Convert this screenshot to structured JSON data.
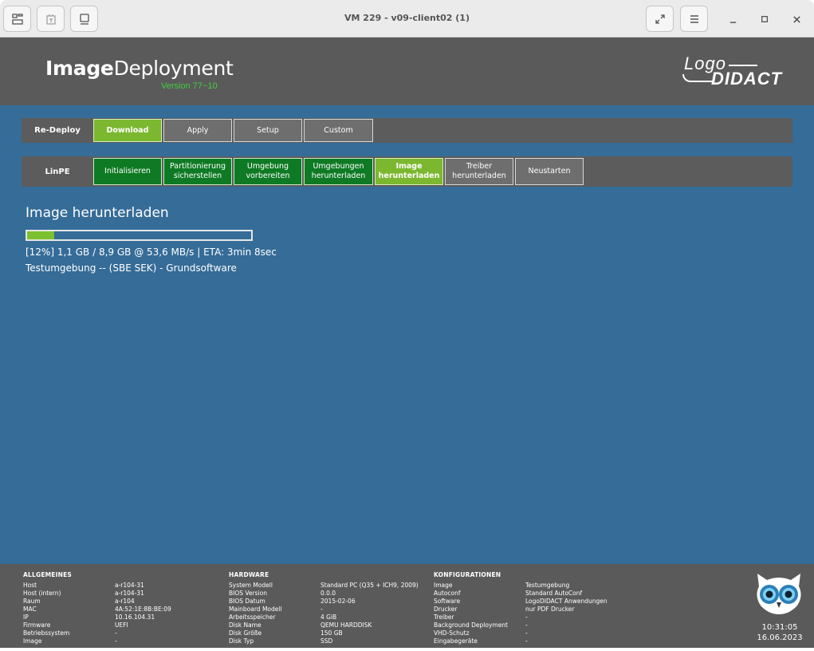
{
  "window": {
    "title": "VM 229 - v09-client02 (1)",
    "left_buttons": [
      "overview-icon",
      "usb-icon",
      "display-icon"
    ],
    "right_buttons": [
      "fullscreen-icon",
      "menu-icon"
    ],
    "controls": [
      "minimize-icon",
      "maximize-icon",
      "close-icon"
    ]
  },
  "header": {
    "brand_bold": "Image",
    "brand_light": "Deployment",
    "version": "Version 77~10",
    "logo_top": "Logo",
    "logo_bottom": "DIDACT"
  },
  "redeploy_row": {
    "label": "Re-Deploy",
    "steps": [
      {
        "label": "Download",
        "state": "active"
      },
      {
        "label": "Apply",
        "state": "inactive"
      },
      {
        "label": "Setup",
        "state": "inactive"
      },
      {
        "label": "Custom",
        "state": "inactive"
      }
    ]
  },
  "linpe_row": {
    "label": "LinPE",
    "steps": [
      {
        "line1": "Initialisieren",
        "line2": "",
        "state": "done"
      },
      {
        "line1": "Partitionierung",
        "line2": "sicherstellen",
        "state": "done"
      },
      {
        "line1": "Umgebung",
        "line2": "vorbereiten",
        "state": "done"
      },
      {
        "line1": "Umgebungen",
        "line2": "herunterladen",
        "state": "done"
      },
      {
        "line1": "Image",
        "line2": "herunterladen",
        "state": "active"
      },
      {
        "line1": "Treiber",
        "line2": "herunterladen",
        "state": "inactive"
      },
      {
        "line1": "Neustarten",
        "line2": "",
        "state": "inactive"
      }
    ]
  },
  "progress": {
    "title": "Image herunterladen",
    "percent": 12,
    "status_text": "[12%] 1,1 GB / 8,9 GB @ 53,6 MB/s | ETA: 3min 8sec",
    "environment_text": "Testumgebung -- (SBE SEK) - Grundsoftware"
  },
  "footer": {
    "allgemeines": {
      "heading": "ALLGEMEINES",
      "rows": [
        [
          "Host",
          "a-r104-31"
        ],
        [
          "Host (intern)",
          "a-r104-31"
        ],
        [
          "Raum",
          "a-r104"
        ],
        [
          "MAC",
          "4A:52:1E:8B:BE:09"
        ],
        [
          "IP",
          "10.16.104.31"
        ],
        [
          "Firmware",
          "UEFI"
        ],
        [
          "Betriebssystem",
          "-"
        ],
        [
          "Image",
          "-"
        ]
      ]
    },
    "hardware": {
      "heading": "HARDWARE",
      "rows": [
        [
          "System Modell",
          "Standard PC (Q35 + ICH9, 2009)"
        ],
        [
          "BIOS Version",
          "0.0.0"
        ],
        [
          "BIOS Datum",
          "2015-02-06"
        ],
        [
          "Mainboard Modell",
          "-"
        ],
        [
          "Arbeitsspeicher",
          "4 GiB"
        ],
        [
          "Disk Name",
          "QEMU HARDDISK"
        ],
        [
          "Disk Größe",
          "150 GB"
        ],
        [
          "Disk Typ",
          "SSD"
        ]
      ]
    },
    "konfigurationen": {
      "heading": "KONFIGURATIONEN",
      "rows": [
        [
          "Image",
          "Testumgebung"
        ],
        [
          "Autoconf",
          "Standard AutoConf"
        ],
        [
          "Software",
          "LogoDIDACT Anwendungen"
        ],
        [
          "Drucker",
          "nur PDF Drucker"
        ],
        [
          "Treiber",
          "-"
        ],
        [
          "Background Deployment",
          "-"
        ],
        [
          "VHD-Schutz",
          "-"
        ],
        [
          "Eingabegeräte",
          "-"
        ]
      ]
    },
    "time": "10:31:05",
    "date": "16.06.2023"
  },
  "colors": {
    "main_bg": "#356c98",
    "header_bg": "#5a5a5a",
    "done_green": "#0e7a24",
    "active_green": "#7cb82f",
    "inactive_gray": "#6e6e6e",
    "version_green": "#3fcf3f"
  }
}
